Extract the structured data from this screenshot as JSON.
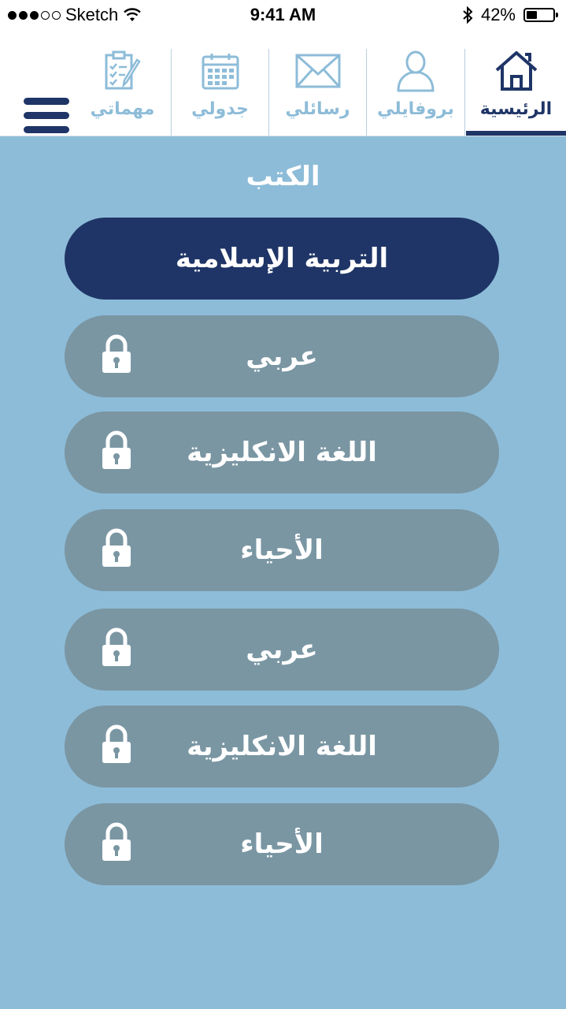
{
  "status_bar": {
    "carrier": "Sketch",
    "time": "9:41 AM",
    "battery": "42%",
    "battery_level": 0.42
  },
  "nav": {
    "tabs": [
      {
        "label": "الرئيسية",
        "icon": "home-icon",
        "active": true
      },
      {
        "label": "بروفايلي",
        "icon": "user-icon",
        "active": false
      },
      {
        "label": "رسائلي",
        "icon": "mail-icon",
        "active": false
      },
      {
        "label": "جدولي",
        "icon": "calendar-icon",
        "active": false
      },
      {
        "label": "مهماتي",
        "icon": "tasks-icon",
        "active": false
      }
    ],
    "menu_icon": "hamburger-menu-icon"
  },
  "section_title": "الكتب",
  "books": [
    {
      "name": "التربية الإسلامية",
      "locked": false,
      "active": true
    },
    {
      "name": "عربي",
      "locked": true,
      "active": false
    },
    {
      "name": "اللغة الانكليزية",
      "locked": true,
      "active": false
    },
    {
      "name": "الأحياء",
      "locked": true,
      "active": false
    },
    {
      "name": "عربي",
      "locked": true,
      "active": false
    },
    {
      "name": "اللغة الانكليزية",
      "locked": true,
      "active": false
    },
    {
      "name": "الأحياء",
      "locked": true,
      "active": false
    }
  ],
  "colors": {
    "background": "#8dbcd8",
    "primary": "#1f3567",
    "locked_button": "#7a96a3",
    "inactive_tab": "#8dbcd8"
  }
}
